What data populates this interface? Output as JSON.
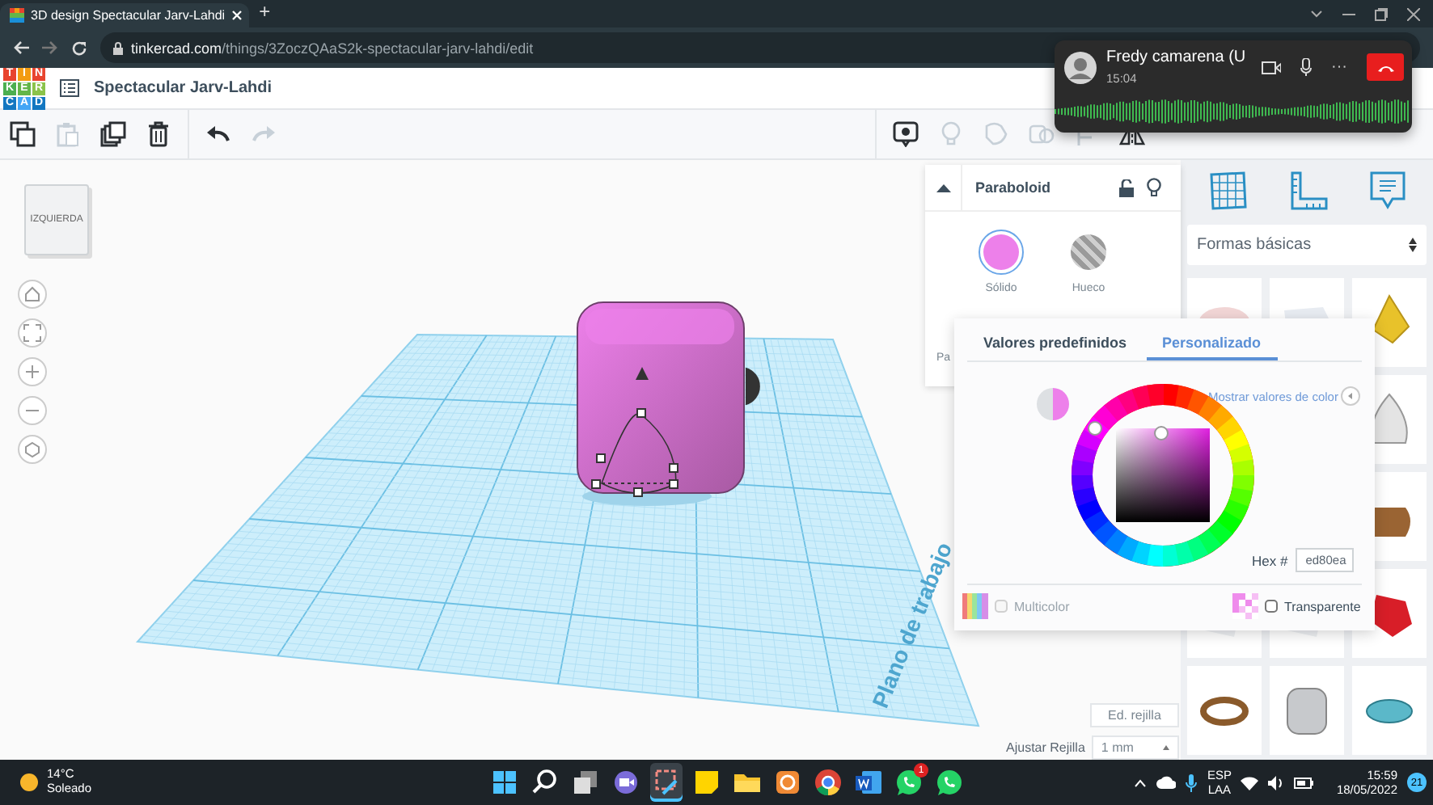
{
  "browser": {
    "tab": {
      "title": "3D design Spectacular Jarv-Lahdi",
      "selected": true
    },
    "new_tab": "+",
    "url": {
      "domain": "tinkercad.com",
      "path": "/things/3ZoczQAaS2k-spectacular-jarv-lahdi/edit"
    }
  },
  "app_header": {
    "logo_letters": [
      "T",
      "I",
      "N",
      "K",
      "E",
      "R",
      "C",
      "A",
      "D"
    ],
    "project_name": "Spectacular Jarv-Lahdi"
  },
  "toolbar": {
    "tools": [
      {
        "kind": "copy",
        "disabled": false
      },
      {
        "kind": "paste",
        "disabled": true
      },
      {
        "kind": "duplicate",
        "disabled": false
      },
      {
        "kind": "delete",
        "disabled": false
      },
      {
        "kind": "undo",
        "disabled": false
      },
      {
        "kind": "redo",
        "disabled": true
      }
    ],
    "view_tools": [
      {
        "kind": "note",
        "disabled": false
      },
      {
        "kind": "bulb",
        "disabled": true
      },
      {
        "kind": "group",
        "disabled": true
      },
      {
        "kind": "ungroup",
        "disabled": true
      },
      {
        "kind": "align",
        "disabled": true
      },
      {
        "kind": "mirror",
        "disabled": false
      }
    ]
  },
  "call": {
    "name": "Fredy camarena (U",
    "time": "15:04",
    "more": "···"
  },
  "viewport": {
    "view_cube_label": "IZQUIERDA",
    "workplane_label": "Plano de trabajo",
    "edit_grid_button": "Ed. rejilla",
    "snap_grid": {
      "label": "Ajustar Rejilla",
      "value": "1 mm"
    }
  },
  "inspector": {
    "shape_name": "Paraboloid",
    "fill_options": [
      {
        "label": "Sólido",
        "kind": "solid",
        "selected": true
      },
      {
        "label": "Hueco",
        "kind": "hole",
        "selected": false
      }
    ],
    "partial_label": "Pa"
  },
  "color_popup": {
    "tabs": [
      {
        "label": "Valores predefinidos",
        "selected": false
      },
      {
        "label": "Personalizado",
        "selected": true
      }
    ],
    "show_values_link": "Mostrar valores de color",
    "hex_label": "Hex #",
    "hex_value": "ed80ea",
    "multicolor": {
      "label": "Multicolor",
      "checked": false,
      "disabled": true
    },
    "transparent": {
      "label": "Transparente",
      "checked": false,
      "disabled": false
    }
  },
  "shapes_panel": {
    "category": "Formas básicas"
  },
  "taskbar": {
    "weather": {
      "temp": "14°C",
      "condition": "Soleado"
    },
    "apps": [
      {
        "kind": "start",
        "selected": false
      },
      {
        "kind": "search",
        "selected": false
      },
      {
        "kind": "taskview",
        "selected": false
      },
      {
        "kind": "chat",
        "selected": false
      },
      {
        "kind": "snip",
        "selected": true
      },
      {
        "kind": "sticky",
        "selected": false
      },
      {
        "kind": "folder",
        "selected": false
      },
      {
        "kind": "office",
        "selected": false
      },
      {
        "kind": "chrome",
        "selected": false
      },
      {
        "kind": "word",
        "selected": false
      },
      {
        "kind": "whatsapp",
        "selected": false,
        "badge": "1"
      },
      {
        "kind": "whatsapp",
        "selected": false
      }
    ],
    "language": {
      "code": "ESP",
      "layout": "LAA"
    },
    "clock": {
      "time": "15:59",
      "date": "18/05/2022"
    },
    "notification_count": "21"
  }
}
